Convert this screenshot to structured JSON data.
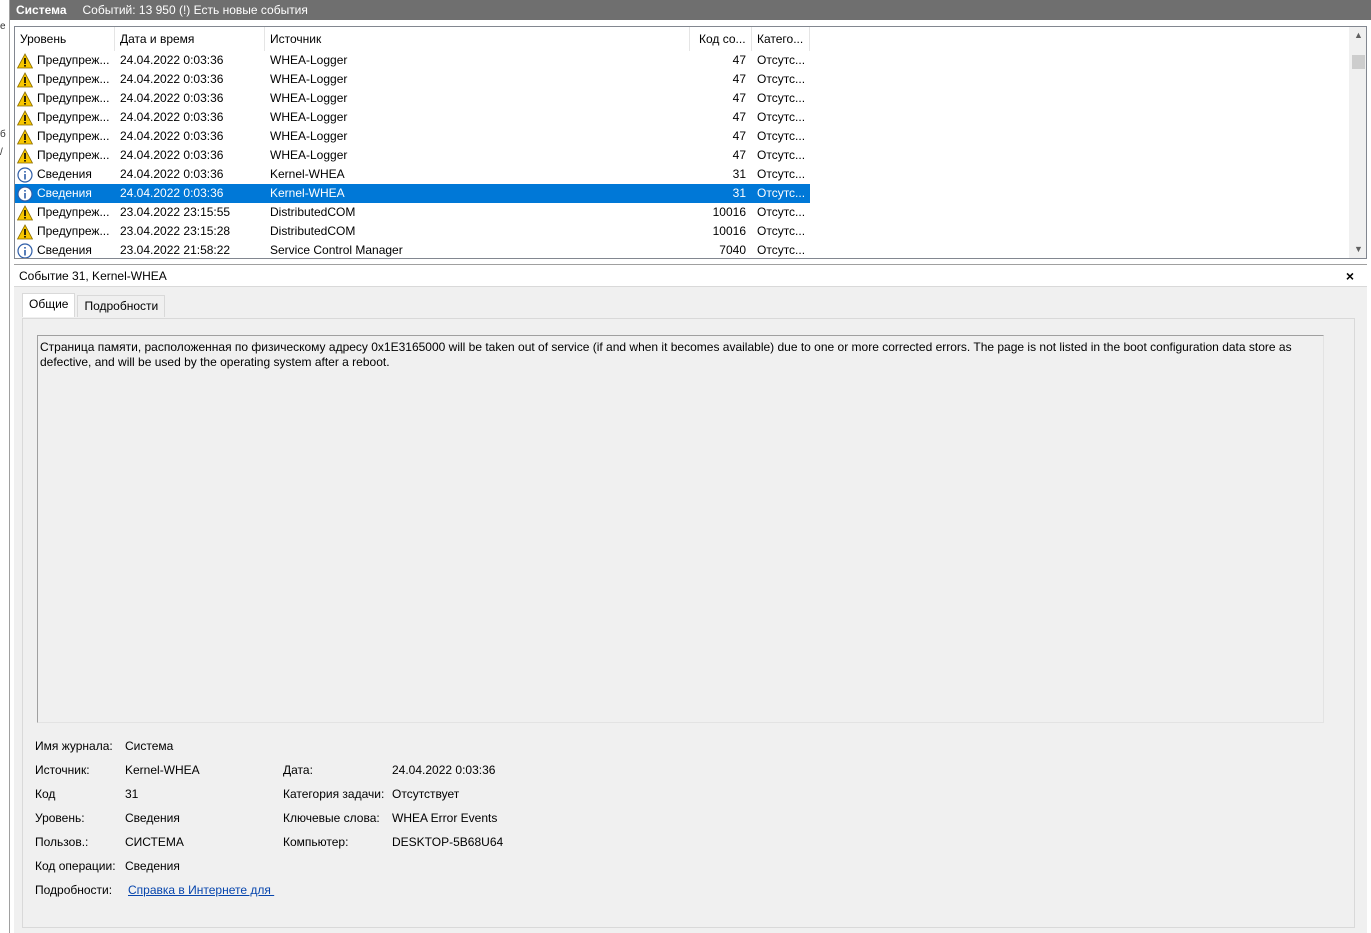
{
  "title_bar": {
    "log_name": "Система",
    "events_info": "Событий: 13 950 (!) Есть новые события"
  },
  "gutter": [
    "е",
    "б",
    "/"
  ],
  "columns": {
    "level": "Уровень",
    "date": "Дата и время",
    "source": "Источник",
    "code": "Код со...",
    "category": "Катего..."
  },
  "rows": [
    {
      "type": "warning-icon",
      "level": "Предупреж...",
      "date": "24.04.2022 0:03:36",
      "source": "WHEA-Logger",
      "code": "47",
      "category": "Отсутс..."
    },
    {
      "type": "warning-icon",
      "level": "Предупреж...",
      "date": "24.04.2022 0:03:36",
      "source": "WHEA-Logger",
      "code": "47",
      "category": "Отсутс..."
    },
    {
      "type": "warning-icon",
      "level": "Предупреж...",
      "date": "24.04.2022 0:03:36",
      "source": "WHEA-Logger",
      "code": "47",
      "category": "Отсутс..."
    },
    {
      "type": "warning-icon",
      "level": "Предупреж...",
      "date": "24.04.2022 0:03:36",
      "source": "WHEA-Logger",
      "code": "47",
      "category": "Отсутс..."
    },
    {
      "type": "warning-icon",
      "level": "Предупреж...",
      "date": "24.04.2022 0:03:36",
      "source": "WHEA-Logger",
      "code": "47",
      "category": "Отсутс..."
    },
    {
      "type": "warning-icon",
      "level": "Предупреж...",
      "date": "24.04.2022 0:03:36",
      "source": "WHEA-Logger",
      "code": "47",
      "category": "Отсутс..."
    },
    {
      "type": "info-icon",
      "level": "Сведения",
      "date": "24.04.2022 0:03:36",
      "source": "Kernel-WHEA",
      "code": "31",
      "category": "Отсутс..."
    },
    {
      "type": "info-icon",
      "level": "Сведения",
      "date": "24.04.2022 0:03:36",
      "source": "Kernel-WHEA",
      "code": "31",
      "category": "Отсутс...",
      "selected": true
    },
    {
      "type": "warning-icon",
      "level": "Предупреж...",
      "date": "23.04.2022 23:15:55",
      "source": "DistributedCOM",
      "code": "10016",
      "category": "Отсутс..."
    },
    {
      "type": "warning-icon",
      "level": "Предупреж...",
      "date": "23.04.2022 23:15:28",
      "source": "DistributedCOM",
      "code": "10016",
      "category": "Отсутс..."
    },
    {
      "type": "info-icon",
      "level": "Сведения",
      "date": "23.04.2022 21:58:22",
      "source": "Service Control Manager",
      "code": "7040",
      "category": "Отсутс..."
    }
  ],
  "details": {
    "header": "Событие 31, Kernel-WHEA",
    "close": "×",
    "tabs": [
      "Общие",
      "Подробности"
    ],
    "description": "Страница памяти, расположенная по физическому адресу 0x1E3165000 will be taken out of service (if and when it becomes available) due to one or more corrected errors. The page is not listed in the boot configuration data store as defective, and will be used by the operating system after a reboot.",
    "props": {
      "log_label": "Имя журнала:",
      "log_value": "Система",
      "source_label": "Источник:",
      "source_value": "Kernel-WHEA",
      "date_label": "Дата:",
      "date_value": "24.04.2022 0:03:36",
      "code_label": "Код",
      "code_value": "31",
      "task_label": "Категория задачи:",
      "task_value": "Отсутствует",
      "level_label": "Уровень:",
      "level_value": "Сведения",
      "keywords_label": "Ключевые слова:",
      "keywords_value": "WHEA Error Events",
      "user_label": "Пользов.:",
      "user_value": "СИСТЕМА",
      "computer_label": "Компьютер:",
      "computer_value": "DESKTOP-5B68U64",
      "opcode_label": "Код операции:",
      "opcode_value": "Сведения",
      "more_label": "Подробности:",
      "more_link": "Справка в Интернете для "
    }
  },
  "colors": {
    "selection": "#0078d7",
    "title_bar": "#6f6f6f",
    "panel": "#f0f0f0",
    "link": "#0645ad"
  }
}
